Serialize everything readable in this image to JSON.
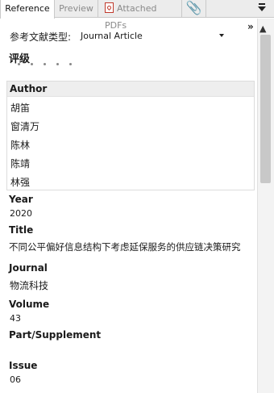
{
  "tabs": {
    "reference": "Reference",
    "preview": "Preview",
    "attached": "Attached PDFs"
  },
  "icons": {
    "pdf": "pdf-icon",
    "clip": "paperclip-icon",
    "menu": "menu-caret-icon",
    "expand": "expand-icon"
  },
  "reference_type": {
    "label": "参考文献类型:",
    "value": "Journal Article"
  },
  "rating": {
    "label": "评级",
    "stars": 5,
    "filled": 0
  },
  "author": {
    "label": "Author",
    "names": [
      "胡笛",
      "窗清万",
      "陈林",
      "陈靖",
      "林强"
    ]
  },
  "fields": [
    {
      "label": "Year",
      "value": "2020"
    },
    {
      "label": "Title",
      "value": "不同公平偏好信息结构下考虑延保服务的供应链决策研究"
    },
    {
      "label": "Journal",
      "value": "物流科技"
    },
    {
      "label": "Volume",
      "value": "43"
    },
    {
      "label": "Part/Supplement",
      "value": ""
    },
    {
      "label": "Issue",
      "value": "06"
    }
  ]
}
